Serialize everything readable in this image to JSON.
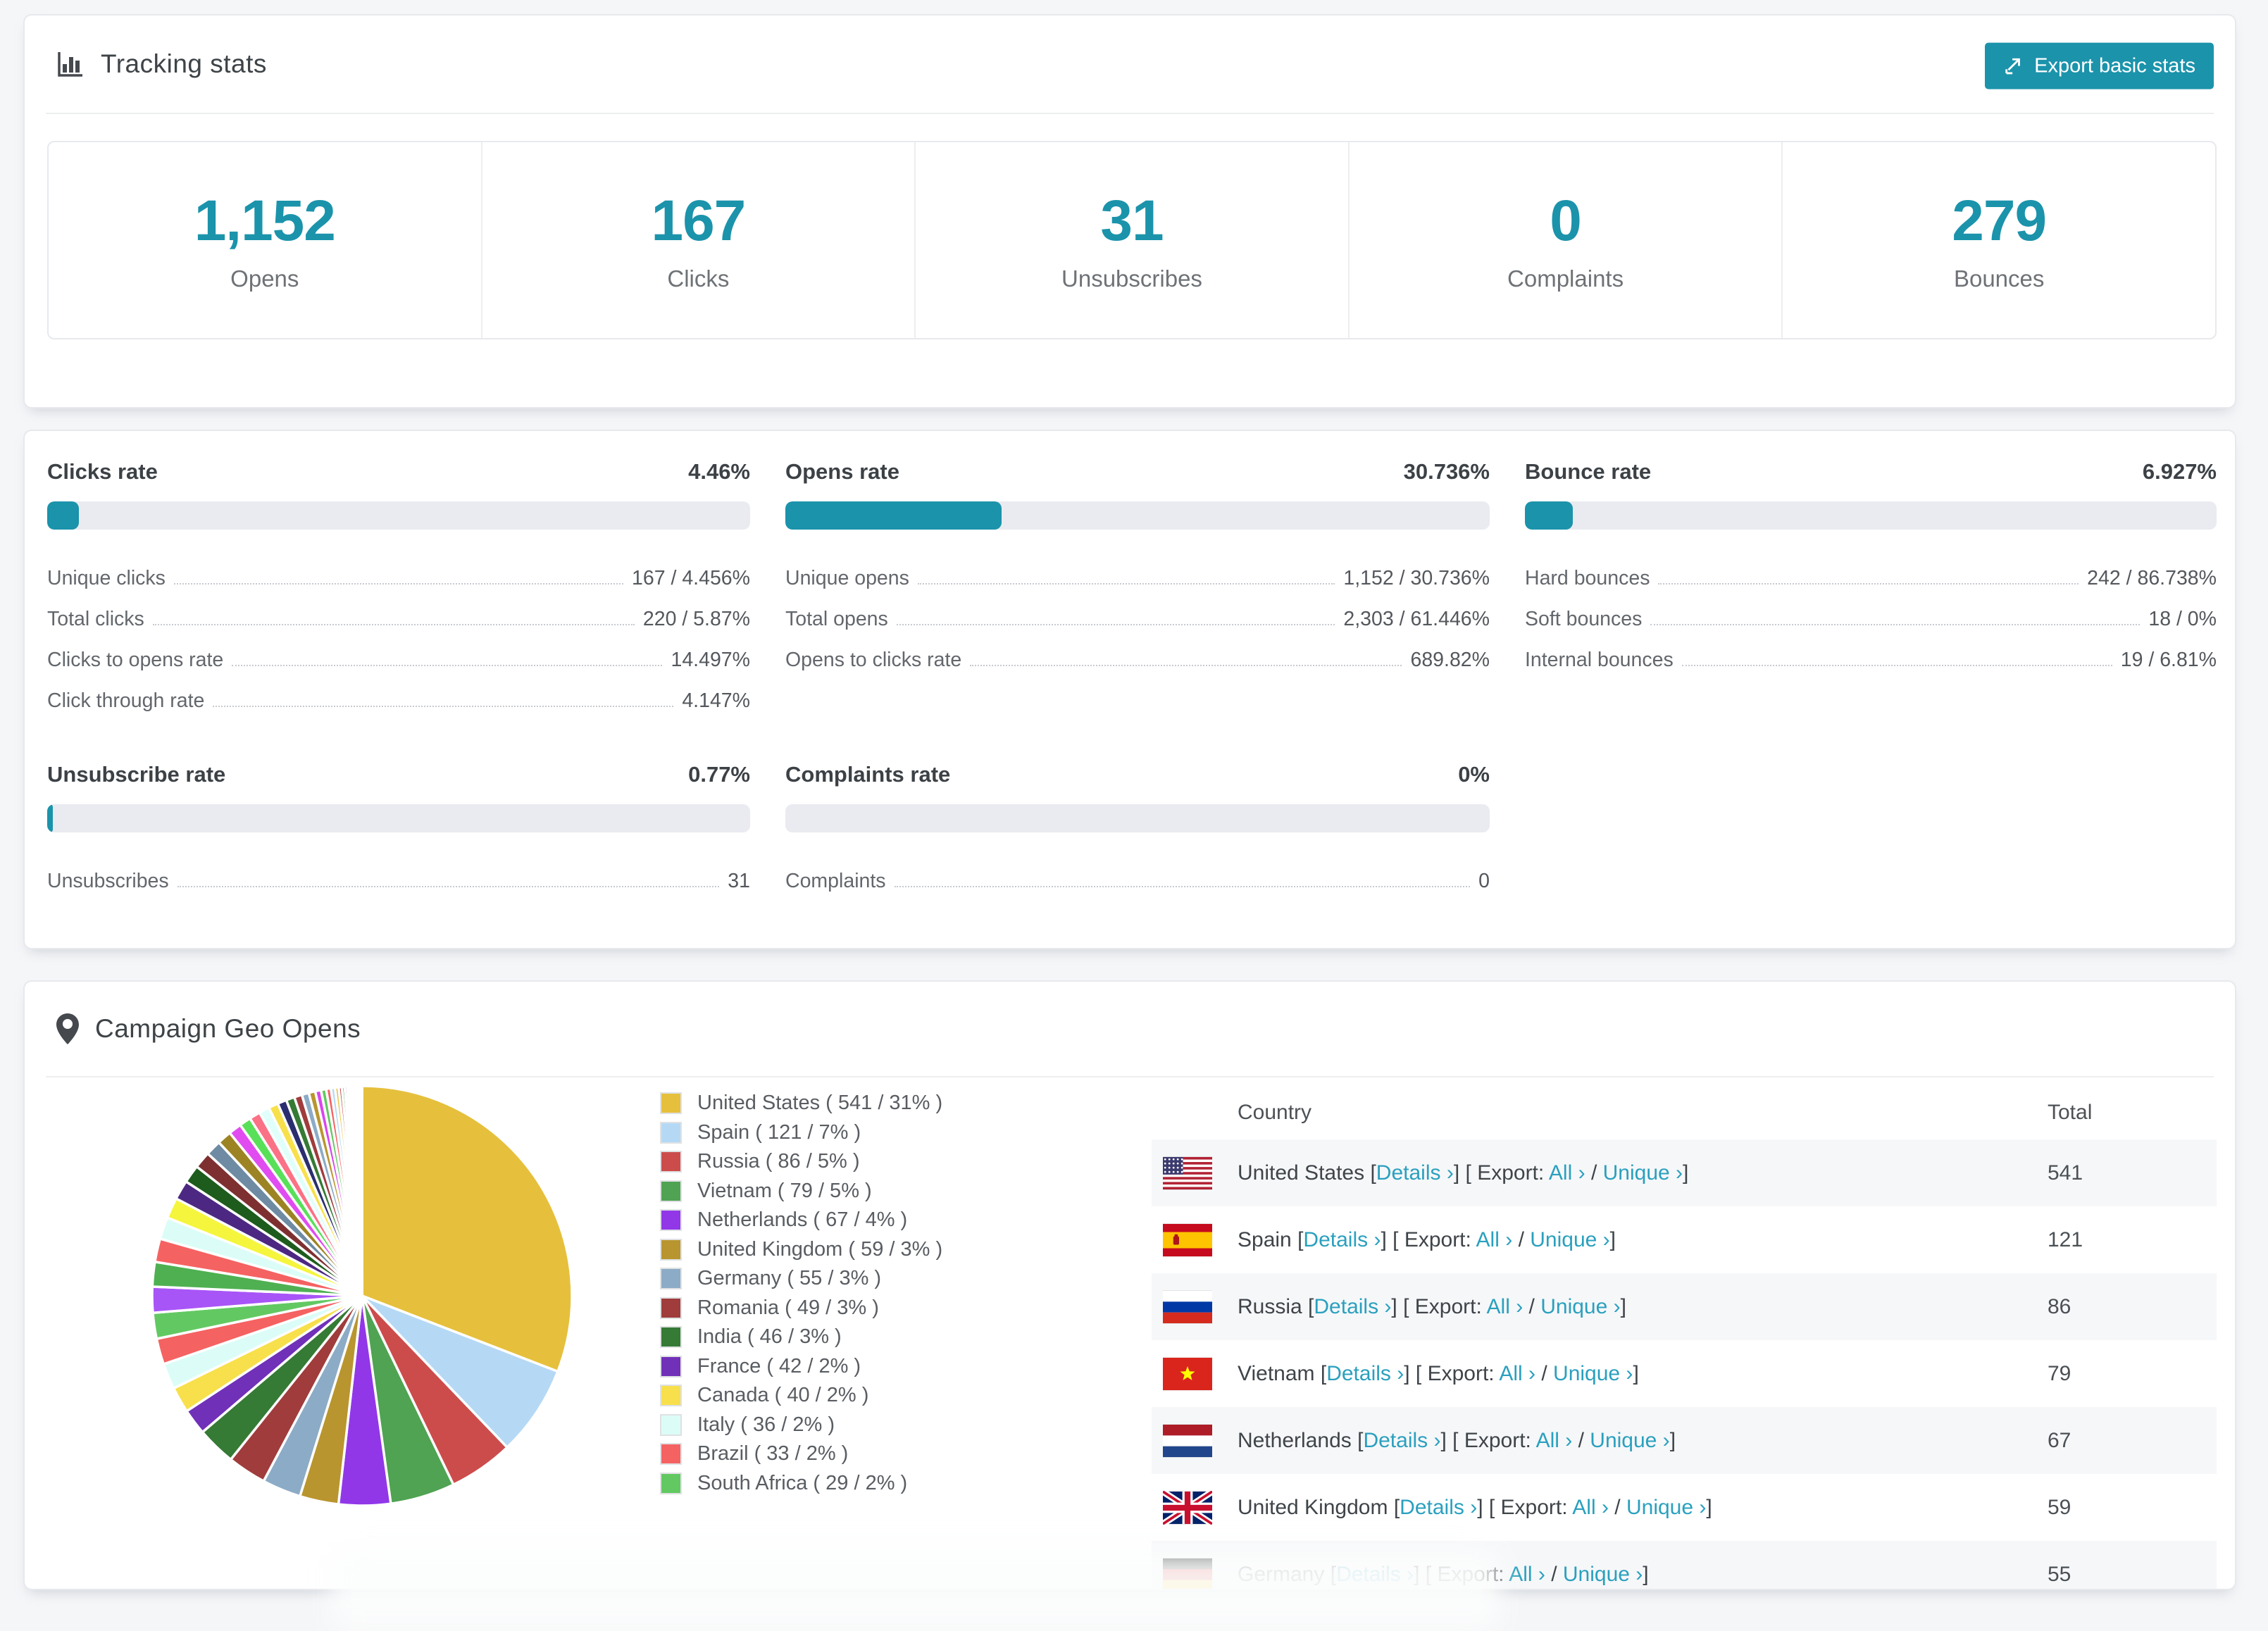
{
  "colors": {
    "accent": "#1b93ab",
    "link": "#2aa0be",
    "page_bg": "#f5f6f8",
    "progress_track": "#e9ebf0",
    "row_stripe": "#f6f7f9"
  },
  "tracking": {
    "title": "Tracking stats",
    "export_label": "Export basic stats",
    "stats": [
      {
        "value": "1,152",
        "label": "Opens"
      },
      {
        "value": "167",
        "label": "Clicks"
      },
      {
        "value": "31",
        "label": "Unsubscribes"
      },
      {
        "value": "0",
        "label": "Complaints"
      },
      {
        "value": "279",
        "label": "Bounces"
      }
    ]
  },
  "rates": [
    {
      "title": "Clicks rate",
      "value": "4.46%",
      "pct": 4.46,
      "rows": [
        {
          "label": "Unique clicks",
          "value": "167 / 4.456%"
        },
        {
          "label": "Total clicks",
          "value": "220 / 5.87%"
        },
        {
          "label": "Clicks to opens rate",
          "value": "14.497%"
        },
        {
          "label": "Click through rate",
          "value": "4.147%"
        }
      ]
    },
    {
      "title": "Opens rate",
      "value": "30.736%",
      "pct": 30.736,
      "rows": [
        {
          "label": "Unique opens",
          "value": "1,152 / 30.736%"
        },
        {
          "label": "Total opens",
          "value": "2,303 / 61.446%"
        },
        {
          "label": "Opens to clicks rate",
          "value": "689.82%"
        }
      ]
    },
    {
      "title": "Bounce rate",
      "value": "6.927%",
      "pct": 6.927,
      "rows": [
        {
          "label": "Hard bounces",
          "value": "242 / 86.738%"
        },
        {
          "label": "Soft bounces",
          "value": "18 / 0%"
        },
        {
          "label": "Internal bounces",
          "value": "19 / 6.81%"
        }
      ]
    },
    {
      "title": "Unsubscribe rate",
      "value": "0.77%",
      "pct": 0.77,
      "rows": [
        {
          "label": "Unsubscribes",
          "value": "31"
        }
      ]
    },
    {
      "title": "Complaints rate",
      "value": "0%",
      "pct": 0,
      "rows": [
        {
          "label": "Complaints",
          "value": "0"
        }
      ]
    }
  ],
  "geo": {
    "title": "Campaign Geo Opens",
    "chart_data": {
      "type": "pie",
      "title": "Campaign Geo Opens",
      "legend_position": "right",
      "start_angle_deg": -90,
      "direction": "clockwise",
      "legend_format": "{name} ( {value} / {pct}% )",
      "series": [
        {
          "name": "United States",
          "value": 541,
          "pct": 31,
          "color": "#e6c03c"
        },
        {
          "name": "Spain",
          "value": 121,
          "pct": 7,
          "color": "#b5d9f5"
        },
        {
          "name": "Russia",
          "value": 86,
          "pct": 5,
          "color": "#cc4c4c"
        },
        {
          "name": "Vietnam",
          "value": 79,
          "pct": 5,
          "color": "#4fa352"
        },
        {
          "name": "Netherlands",
          "value": 67,
          "pct": 4,
          "color": "#9137e8"
        },
        {
          "name": "United Kingdom",
          "value": 59,
          "pct": 3,
          "color": "#b9952f"
        },
        {
          "name": "Germany",
          "value": 55,
          "pct": 3,
          "color": "#8cabc6"
        },
        {
          "name": "Romania",
          "value": 49,
          "pct": 3,
          "color": "#a03c3c"
        },
        {
          "name": "India",
          "value": 46,
          "pct": 3,
          "color": "#357a35"
        },
        {
          "name": "France",
          "value": 42,
          "pct": 2,
          "color": "#7030b8"
        },
        {
          "name": "Canada",
          "value": 40,
          "pct": 2,
          "color": "#f7e04b"
        },
        {
          "name": "Italy",
          "value": 36,
          "pct": 2,
          "color": "#dcfdf7"
        },
        {
          "name": "Brazil",
          "value": 33,
          "pct": 2,
          "color": "#f56262"
        },
        {
          "name": "South Africa",
          "value": 29,
          "pct": 2,
          "color": "#62c962"
        }
      ],
      "others": {
        "note": "many small unlabeled countries, decreasing size, colors cycle",
        "values": [
          2.0,
          1.9,
          1.8,
          1.7,
          1.6,
          1.5,
          1.4,
          1.3,
          1.2,
          1.1,
          1.0,
          0.9,
          0.85,
          0.8,
          0.75,
          0.7,
          0.65,
          0.6,
          0.55,
          0.5,
          0.45,
          0.4,
          0.36,
          0.32,
          0.28,
          0.25,
          0.22,
          0.2,
          0.18,
          0.16,
          0.14,
          0.12,
          0.1,
          0.09,
          0.08,
          0.07,
          0.06,
          0.05,
          0.04,
          0.03
        ],
        "colors": [
          "#a855f7",
          "#4fb052",
          "#f56262",
          "#dcfdf7",
          "#f5f53e",
          "#4c2882",
          "#1d5c1d",
          "#7e3030",
          "#6e8ba3",
          "#9c8424",
          "#e04cf0",
          "#58e058",
          "#fb7185",
          "#e0fffa",
          "#f7e04b",
          "#2b2e6e",
          "#357a35",
          "#a03c3c",
          "#8cabc6",
          "#b9952f",
          "#d946ef",
          "#62c962",
          "#f56262",
          "#b5d9f5",
          "#e6c03c",
          "#cc4c4c",
          "#4fa352",
          "#9137e8"
        ]
      }
    },
    "table": {
      "country_header": "Country",
      "total_header": "Total",
      "labels": {
        "open": "[",
        "close": "]",
        "slash": "/",
        "details": "Details ›",
        "export": "Export:",
        "all": "All ›",
        "unique": "Unique ›"
      },
      "rows": [
        {
          "country": "United States",
          "total": "541",
          "flag": "us"
        },
        {
          "country": "Spain",
          "total": "121",
          "flag": "es"
        },
        {
          "country": "Russia",
          "total": "86",
          "flag": "ru"
        },
        {
          "country": "Vietnam",
          "total": "79",
          "flag": "vn"
        },
        {
          "country": "Netherlands",
          "total": "67",
          "flag": "nl"
        },
        {
          "country": "United Kingdom",
          "total": "59",
          "flag": "gb"
        },
        {
          "country": "Germany",
          "total": "55",
          "flag": "de"
        }
      ]
    }
  }
}
